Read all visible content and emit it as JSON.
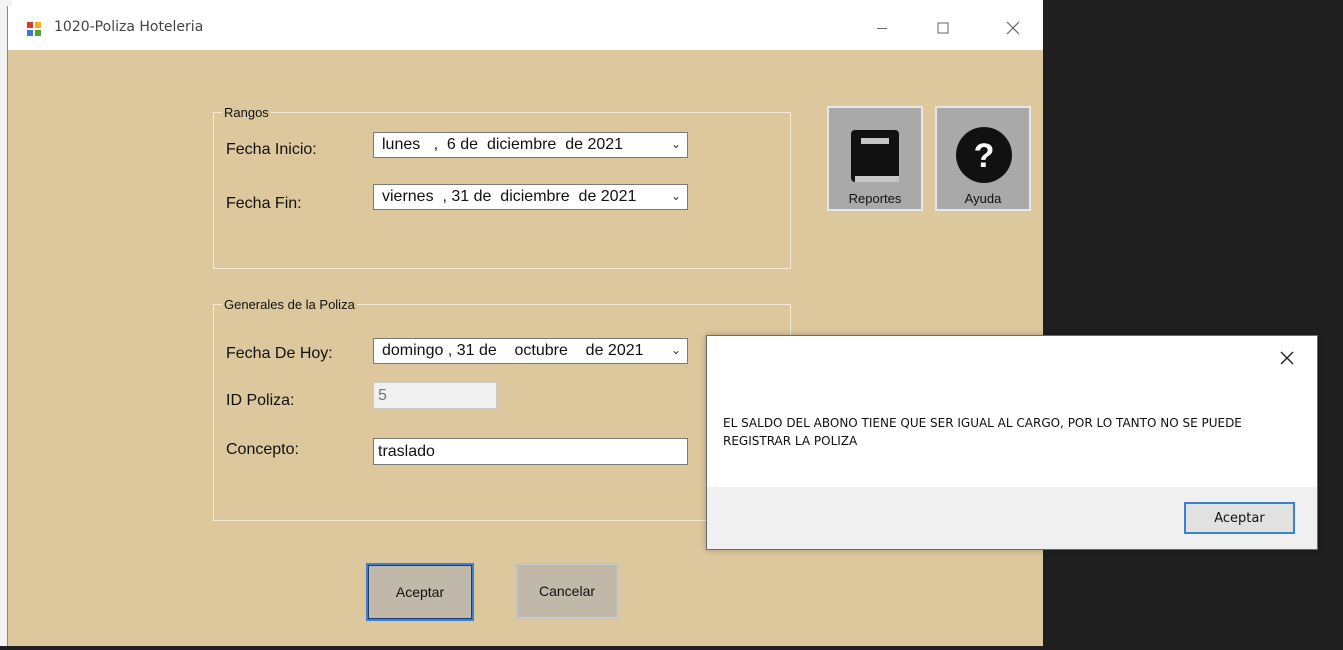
{
  "window": {
    "title": "1020-Poliza Hoteleria",
    "minimize_icon": "minimize-icon",
    "maximize_icon": "maximize-icon",
    "close_icon": "close-icon"
  },
  "rangos": {
    "title": "Rangos",
    "fecha_inicio_label": "Fecha Inicio:",
    "fecha_inicio_value": "lunes   ,  6 de  diciembre  de 2021",
    "fecha_fin_label": "Fecha Fin:",
    "fecha_fin_value": "viernes  , 31 de  diciembre  de 2021"
  },
  "toolbar": {
    "reportes_label": "Reportes",
    "reportes_icon": "book-icon",
    "ayuda_label": "Ayuda",
    "ayuda_icon": "question-mark-icon"
  },
  "generales": {
    "title": "Generales de la Poliza",
    "fecha_hoy_label": "Fecha De Hoy:",
    "fecha_hoy_value": "domingo , 31 de    octubre    de 2021",
    "id_poliza_label": "ID Poliza:",
    "id_poliza_value": "5",
    "concepto_label": "Concepto:",
    "concepto_value": "traslado"
  },
  "buttons": {
    "aceptar": "Aceptar",
    "cancelar": "Cancelar"
  },
  "dialog": {
    "message": "EL SALDO DEL ABONO TIENE QUE SER IGUAL AL CARGO, POR LO TANTO NO SE PUEDE REGISTRAR LA POLIZA",
    "ok_label": "Aceptar",
    "close_icon": "close-icon"
  },
  "colors": {
    "form_background": "#ddc79c",
    "dialog_button_border": "#3c7fd0",
    "primary_button_border": "#3c7fd0"
  }
}
